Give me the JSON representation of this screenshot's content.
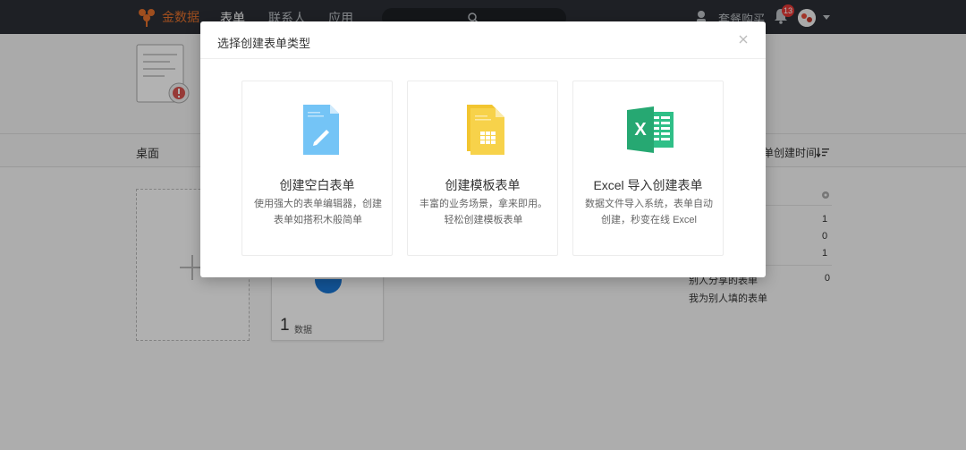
{
  "app": {
    "brand_name": "金数据",
    "brand_color": "#e4702c",
    "nav": [
      {
        "label": "表单",
        "active": true
      },
      {
        "label": "联系人",
        "active": false
      },
      {
        "label": "应用",
        "active": false
      }
    ],
    "purchase_label": "套餐购买",
    "notification_count": "13",
    "icons": [
      "logo-icon",
      "search-icon",
      "support-icon",
      "bell-icon",
      "avatar",
      "chevron-down-icon"
    ]
  },
  "page": {
    "desk_tab": "桌面",
    "sort_label": "单创建时间",
    "form_card": {
      "count": "1",
      "unit": "数据"
    },
    "side_stats": [
      {
        "label": "",
        "value": "1"
      },
      {
        "label": "",
        "value": "0"
      },
      {
        "label": "",
        "value": "1"
      },
      {
        "label": "别人分享的表单",
        "value": "0"
      },
      {
        "label": "我为别人填的表单",
        "value": ""
      }
    ]
  },
  "modal": {
    "title": "选择创建表单类型",
    "options": [
      {
        "title": "创建空白表单",
        "desc": "使用强大的表单编辑器，创建表单如搭积木般简单",
        "icon": "blank-form-icon",
        "color": "#74c4f6"
      },
      {
        "title": "创建模板表单",
        "desc": "丰富的业务场景，拿来即用。轻松创建模板表单",
        "icon": "template-form-icon",
        "color": "#f7d24a"
      },
      {
        "title": "Excel 导入创建表单",
        "desc": "数据文件导入系统，表单自动创建，秒变在线 Excel",
        "icon": "excel-icon",
        "color": "#2fbf87"
      }
    ]
  }
}
